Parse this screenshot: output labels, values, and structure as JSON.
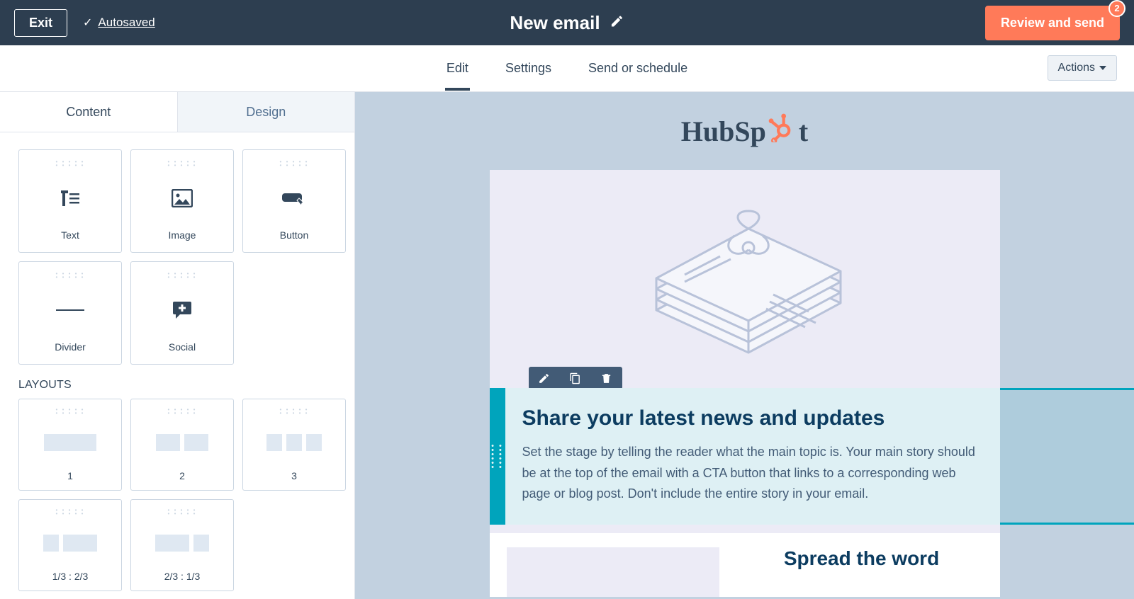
{
  "topbar": {
    "exit": "Exit",
    "autosaved": "Autosaved",
    "title": "New email",
    "review": "Review and send",
    "badge": "2"
  },
  "tabs": {
    "items": [
      {
        "label": "Edit",
        "active": true
      },
      {
        "label": "Settings",
        "active": false
      },
      {
        "label": "Send or schedule",
        "active": false
      }
    ],
    "actions": "Actions"
  },
  "sidebar": {
    "tabs": {
      "content": "Content",
      "design": "Design"
    },
    "blocks": [
      {
        "label": "Text"
      },
      {
        "label": "Image"
      },
      {
        "label": "Button"
      },
      {
        "label": "Divider"
      },
      {
        "label": "Social"
      }
    ],
    "layouts_title": "LAYOUTS",
    "layouts": [
      {
        "label": "1"
      },
      {
        "label": "2"
      },
      {
        "label": "3"
      },
      {
        "label": "1/3 : 2/3"
      },
      {
        "label": "2/3 : 1/3"
      }
    ]
  },
  "email": {
    "logo_text_a": "HubSp",
    "logo_text_b": "t",
    "heading": "Share your latest news and updates",
    "body": "Set the stage by telling the reader what the main topic is. Your main story should be at the top of the email with a CTA button that links to a corresponding web page or blog post. Don't include the entire story in your email.",
    "subheading": "Spread the word"
  }
}
